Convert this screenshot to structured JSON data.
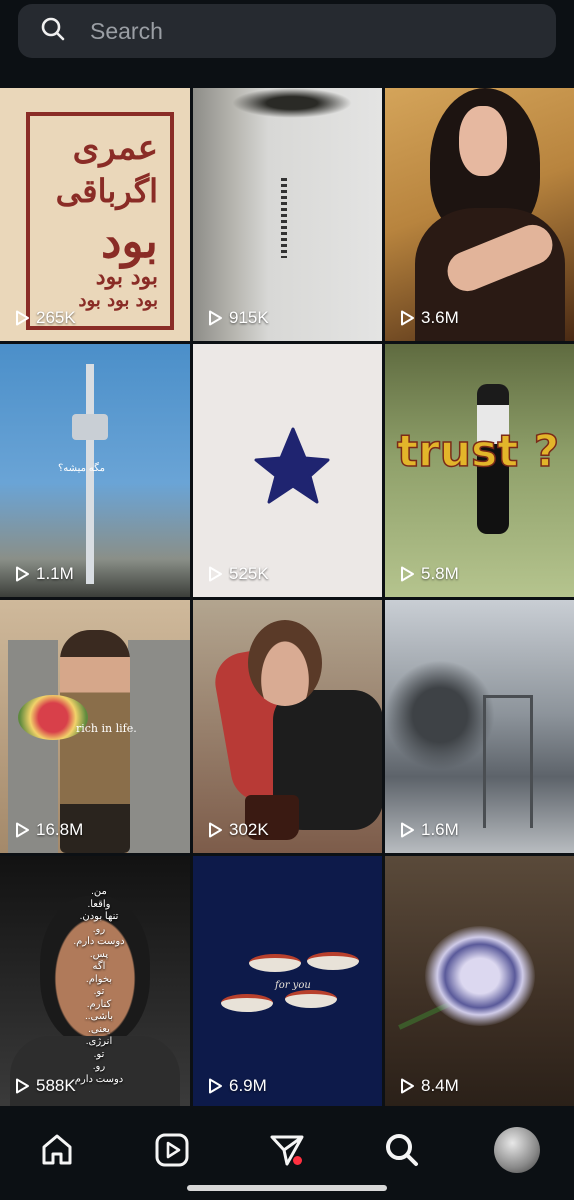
{
  "search": {
    "placeholder": "Search"
  },
  "tiles": [
    {
      "views": "265K",
      "overlay_lines": [
        "عمری",
        "اگرباقی",
        "بود",
        "بود بود",
        "بود بود بود"
      ]
    },
    {
      "views": "915K"
    },
    {
      "views": "3.6M"
    },
    {
      "views": "1.1M",
      "overlay": "مگه میشه؟"
    },
    {
      "views": "525K"
    },
    {
      "views": "5.8M",
      "overlay": "trust ?"
    },
    {
      "views": "16.8M",
      "overlay": "rich in life."
    },
    {
      "views": "302K"
    },
    {
      "views": "1.6M"
    },
    {
      "views": "588K",
      "overlay_lines": [
        "من.",
        "واقعا.",
        "تنها بودن.",
        "رو.",
        "دوست دارم.",
        "پس.",
        "اگه",
        "بخوام.",
        "تو.",
        "کنارم.",
        "باشی..",
        "یعنی.",
        "انرژی.",
        "تو.",
        "رو.",
        "دوست دارم"
      ]
    },
    {
      "views": "6.9M",
      "overlay": "for you"
    },
    {
      "views": "8.4M"
    }
  ],
  "nav": {
    "items": [
      {
        "icon": "home-icon"
      },
      {
        "icon": "reels-icon"
      },
      {
        "icon": "send-icon",
        "has_notification_dot": true
      },
      {
        "icon": "search-icon",
        "active": true
      },
      {
        "icon": "profile-avatar"
      }
    ]
  },
  "colors": {
    "background": "#0c1014",
    "search_bg": "#262a30",
    "notification": "#ff3040"
  }
}
